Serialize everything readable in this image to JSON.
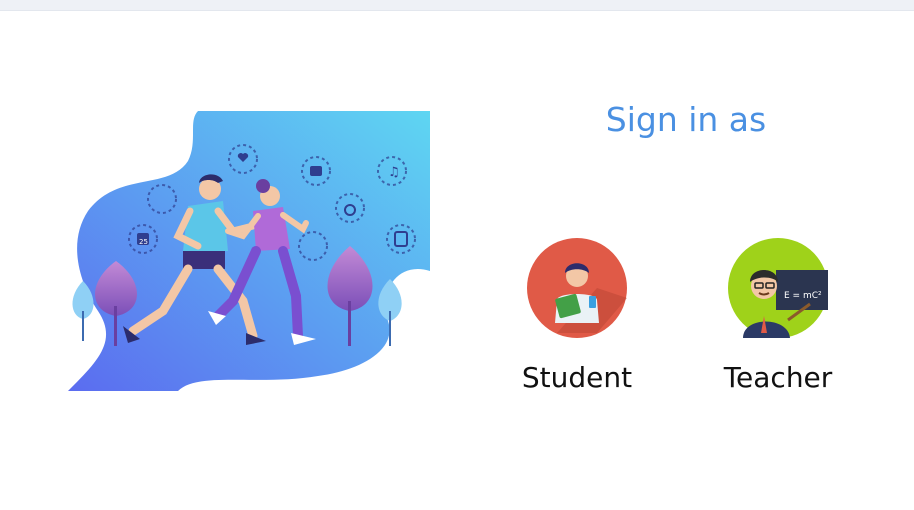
{
  "topbar": {
    "tab_stub": ""
  },
  "title": "Sign in as",
  "roles": [
    {
      "label": "Student",
      "icon": "student-avatar-icon",
      "color": "#e05a47"
    },
    {
      "label": "Teacher",
      "icon": "teacher-avatar-icon",
      "color": "#9fd21a"
    }
  ],
  "hero": {
    "icon": "runners-illustration",
    "calendar_day": "25"
  },
  "colors": {
    "title": "#4a90e2",
    "hero_gradient_start": "#5b6cf0",
    "hero_gradient_end": "#5ed6f2"
  }
}
